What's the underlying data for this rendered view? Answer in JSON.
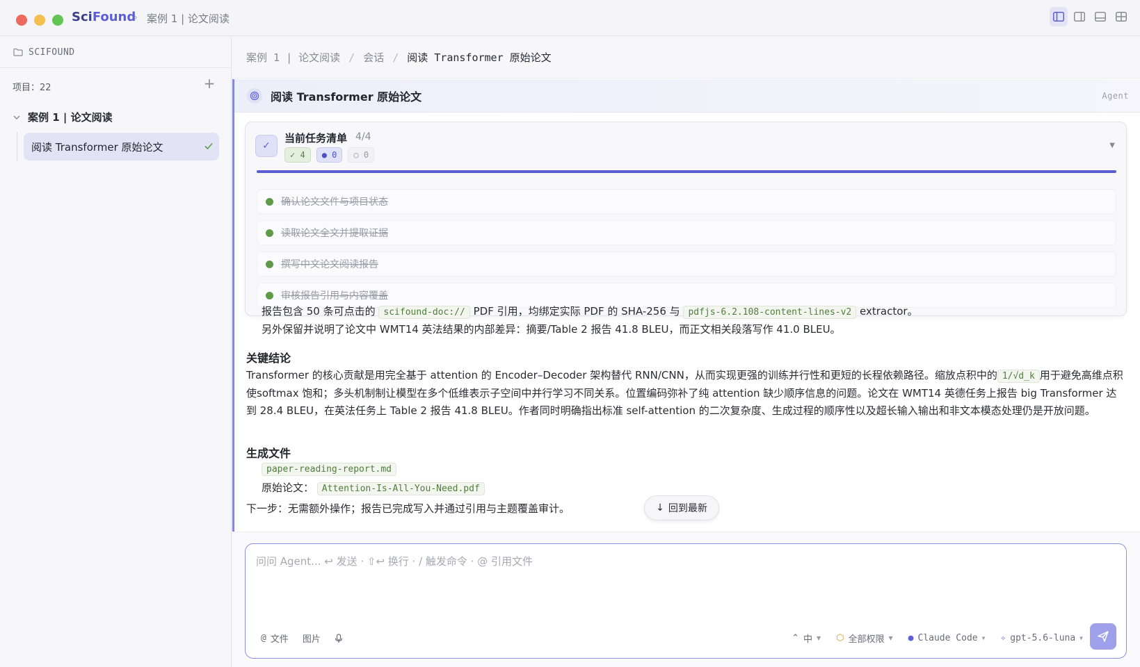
{
  "app": {
    "brand_sci": "Sci",
    "brand_found": "Found",
    "title_crumb": "案例 1 | 论文阅读"
  },
  "sidebar": {
    "header": "SCIFOUND",
    "project_count": "项目：22",
    "group_label": "案例 1 | 论文阅读",
    "active_item": "阅读 Transformer 原始论文"
  },
  "breadcrumb": {
    "items": [
      "案例 1 | 论文阅读",
      "会话",
      "阅读 Transformer 原始论文"
    ]
  },
  "session": {
    "title": "阅读 Transformer 原始论文",
    "tag": "Agent"
  },
  "task_card": {
    "title": "当前任务清单",
    "progress_text": "4/4",
    "progress_fraction": 1.0,
    "badge_done": "✓ 4",
    "badge_running": "● 0",
    "badge_pending": "○ 0",
    "tasks": [
      "确认论文文件与项目状态",
      "读取论文全文并提取证据",
      "撰写中文论文阅读报告",
      "审核报告引用与内容覆盖"
    ]
  },
  "message": {
    "line1_a": "报告包含 50 条可点击的",
    "line1_code1": "scifound-doc://",
    "line1_b": "PDF 引用，均绑定实际 PDF 的 SHA-256 与",
    "line1_code2": "pdfjs-6.2.108-content-lines-v2",
    "line1_c": "extractor。",
    "line2": "另外保留并说明了论文中 WMT14 英法结果的内部差异：摘要/Table 2 报告 41.8 BLEU，而正文相关段落写作 41.0 BLEU。",
    "conclusions_heading": "关键结论",
    "para1_a": "Transformer 的核心贡献是用完全基于 attention 的 Encoder–Decoder 架构替代 RNN/CNN，从而实现更强的训练并行性和更短的长程依赖路径。缩放点积中的",
    "para1_code": "1/√d_k",
    "para1_b": "用于避免高维点积使softmax 饱和；多头机制制让模型在多个低维表示子空间中并行学习不同关系。位置编码弥补了纯 attention 缺少顺序信息的问题。论文在 WMT14 英德任务上报告 big Transformer 达到 28.4 BLEU，在英法任务上 Table 2 报告 41.8 BLEU。作者同时明确指出标准 self-attention 的二次复杂度、生成过程的顺序性以及超长输入输出和非文本模态处理仍是开放问题。",
    "files_heading": "生成文件",
    "file1": "paper-reading-report.md",
    "file2_label": "原始论文：",
    "file2": "Attention-Is-All-You-Need.pdf",
    "next_step": "下一步：无需额外操作；报告已完成写入并通过引用与主题覆盖审计。"
  },
  "jump_button": "回到最新",
  "composer": {
    "placeholder": "问问 Agent... ↩ 发送 · ⇧↩ 换行 · / 触发命令 · @ 引用文件",
    "file_btn": "文件",
    "image_btn": "图片",
    "effort": "中",
    "permission": "全部权限",
    "engine": "Claude Code",
    "model": "gpt-5.6-luna"
  }
}
